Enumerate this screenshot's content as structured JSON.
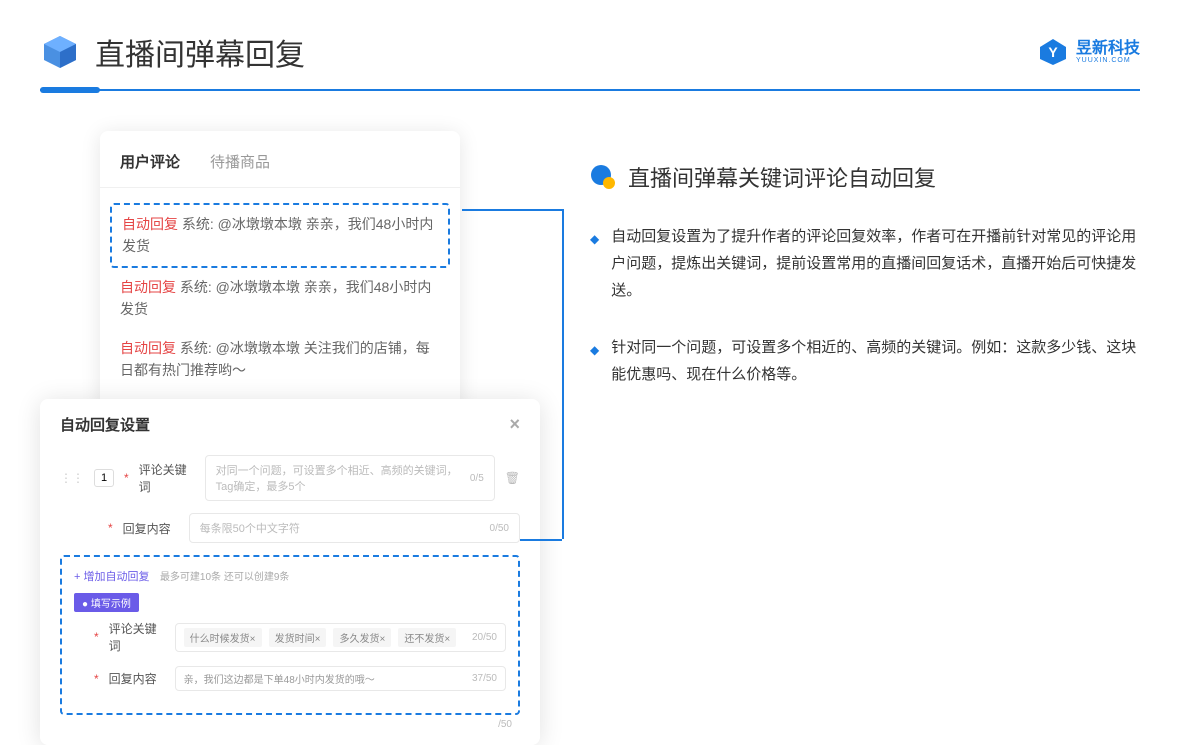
{
  "header": {
    "title": "直播间弹幕回复",
    "logo_cn": "昱新科技",
    "logo_en": "YUUXIN.COM"
  },
  "comments": {
    "tab_active": "用户评论",
    "tab_inactive": "待播商品",
    "items": [
      {
        "tag": "自动回复",
        "text": "系统: @冰墩墩本墩 亲亲，我们48小时内发货"
      },
      {
        "tag": "自动回复",
        "text": "系统: @冰墩墩本墩 亲亲，我们48小时内发货"
      },
      {
        "tag": "自动回复",
        "text": "系统: @冰墩墩本墩 关注我们的店铺，每日都有热门推荐哟～"
      }
    ]
  },
  "settings": {
    "title": "自动回复设置",
    "row_index": "1",
    "keyword_label": "评论关键词",
    "keyword_placeholder": "对同一个问题，可设置多个相近、高频的关键词，Tag确定，最多5个",
    "keyword_counter": "0/5",
    "content_label": "回复内容",
    "content_placeholder": "每条限50个中文字符",
    "content_counter": "0/50",
    "add_link": "+ 增加自动回复",
    "add_hint": "最多可建10条 还可以创建9条",
    "example_badge": "● 填写示例",
    "example_kw_label": "评论关键词",
    "example_tags": [
      "什么时候发货×",
      "发货时间×",
      "多久发货×",
      "还不发货×"
    ],
    "example_kw_counter": "20/50",
    "example_content_label": "回复内容",
    "example_content_text": "亲，我们这边都是下单48小时内发货的哦～",
    "example_content_counter": "37/50",
    "extra_counter": "/50"
  },
  "right": {
    "section_title": "直播间弹幕关键词评论自动回复",
    "bullets": [
      "自动回复设置为了提升作者的评论回复效率，作者可在开播前针对常见的评论用户问题，提炼出关键词，提前设置常用的直播间回复话术，直播开始后可快捷发送。",
      "针对同一个问题，可设置多个相近的、高频的关键词。例如：这款多少钱、这块能优惠吗、现在什么价格等。"
    ]
  }
}
